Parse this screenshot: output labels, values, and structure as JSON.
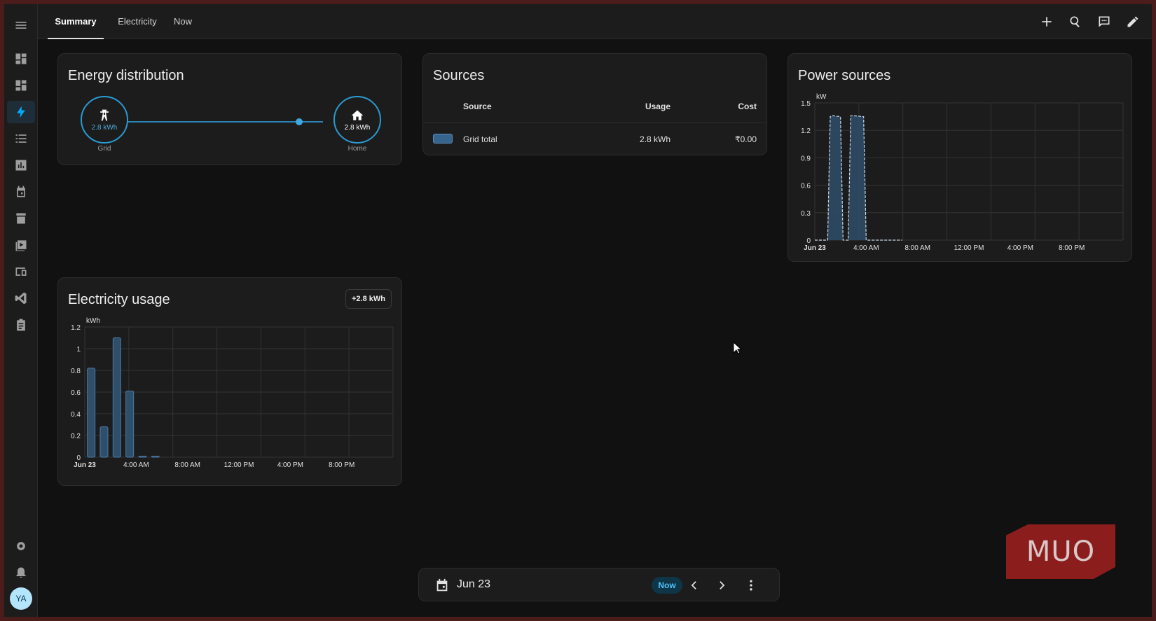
{
  "tabs": [
    {
      "label": "Summary",
      "active": true
    },
    {
      "label": "Electricity",
      "active": false
    },
    {
      "label": "Now",
      "active": false
    }
  ],
  "sidebar": {
    "icons": [
      "menu-icon",
      "dashboard-icon",
      "dashboard-alt-icon",
      "energy-icon",
      "logbook-icon",
      "history-icon",
      "calendar-icon",
      "hacs-icon",
      "media-icon",
      "devices-icon",
      "vscode-icon",
      "todo-icon"
    ],
    "bottom_icons": [
      "settings-icon",
      "notifications-icon"
    ],
    "avatar": "YA"
  },
  "energy_distribution": {
    "title": "Energy distribution",
    "grid": {
      "value": "2.8 kWh",
      "label": "Grid"
    },
    "home": {
      "value": "2.8 kWh",
      "label": "Home"
    }
  },
  "sources": {
    "title": "Sources",
    "headers": {
      "source": "Source",
      "usage": "Usage",
      "cost": "Cost"
    },
    "rows": [
      {
        "source": "Grid total",
        "usage": "2.8 kWh",
        "cost": "₹0.00"
      }
    ]
  },
  "power_sources": {
    "title": "Power sources",
    "unit": "kW"
  },
  "electricity_usage": {
    "title": "Electricity usage",
    "badge": "+2.8 kWh",
    "unit": "kWh"
  },
  "date_picker": {
    "date": "Jun 23",
    "now_label": "Now"
  },
  "watermark": "MUO",
  "chart_data": [
    {
      "type": "area",
      "title": "Power sources",
      "ylabel": "kW",
      "ylim": [
        0,
        1.5
      ],
      "yticks": [
        "0",
        "0.3",
        "0.6",
        "0.9",
        "1.2",
        "1.5"
      ],
      "xticks": [
        "Jun 23",
        "4:00 AM",
        "8:00 AM",
        "12:00 PM",
        "4:00 PM",
        "8:00 PM"
      ],
      "xlim": [
        0,
        24
      ],
      "series": [
        {
          "x": [
            0,
            1.0,
            1.2,
            1.4,
            2.0,
            2.2,
            2.6,
            2.8,
            3.0,
            3.8,
            4.0,
            4.2,
            6.8
          ],
          "values": [
            0,
            0,
            1.35,
            1.36,
            1.35,
            0,
            0,
            1.36,
            1.36,
            1.35,
            0,
            0,
            0
          ]
        }
      ]
    },
    {
      "type": "bar",
      "title": "Electricity usage",
      "ylabel": "kWh",
      "ylim": [
        0,
        1.2
      ],
      "yticks": [
        "0",
        "0.2",
        "0.4",
        "0.6",
        "0.8",
        "1",
        "1.2"
      ],
      "xticks": [
        "Jun 23",
        "4:00 AM",
        "8:00 AM",
        "12:00 PM",
        "4:00 PM",
        "8:00 PM"
      ],
      "xlim": [
        0,
        24
      ],
      "x": [
        1,
        2,
        3,
        4,
        5,
        6
      ],
      "values": [
        0.82,
        0.28,
        1.1,
        0.61,
        0.01,
        0.01
      ]
    }
  ]
}
